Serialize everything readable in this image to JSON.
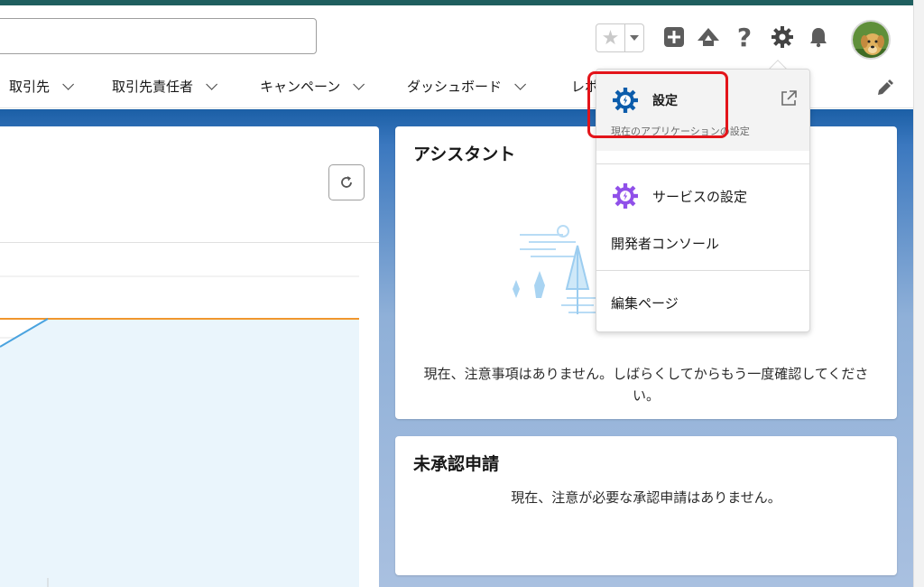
{
  "header": {
    "search_value": "",
    "icons": [
      "star-icon",
      "chevron-down-icon",
      "add-icon",
      "trailhead-icon",
      "help-icon",
      "gear-icon",
      "bell-icon"
    ],
    "help_glyph": "?"
  },
  "nav": {
    "items": [
      {
        "label": "取引先"
      },
      {
        "label": "取引先責任者"
      },
      {
        "label": "キャンペーン"
      },
      {
        "label": "ダッシュボード"
      },
      {
        "label": "レポ"
      }
    ]
  },
  "assistant": {
    "title": "アシスタント",
    "message": "現在、注意事項はありません。しばらくしてからもう一度確認してください。"
  },
  "approvals": {
    "title": "未承認申請",
    "message": "現在、注意が必要な承認申請はありません。"
  },
  "setup_menu": {
    "setup_label": "設定",
    "setup_sub": "現在のアプリケーションの設定",
    "service_setup_label": "サービスの設定",
    "dev_console_label": "開発者コンソール",
    "edit_page_label": "編集ページ"
  },
  "colors": {
    "brand_blue": "#1b5fa6",
    "highlight_red": "#e3141a",
    "setup_gear": "#0b5cab",
    "service_gear": "#9050e9",
    "chart_orange": "#f0962d",
    "chart_blue": "#4aa3df"
  }
}
